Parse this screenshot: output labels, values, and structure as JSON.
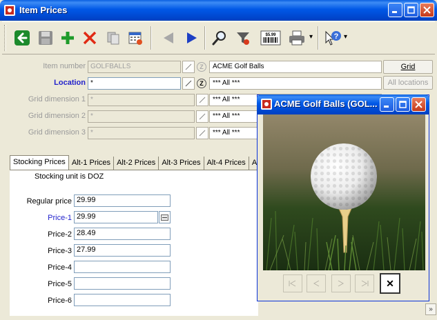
{
  "window": {
    "title": "Item Prices",
    "minimize": "_",
    "maximize": "□",
    "close": "✕"
  },
  "toolbar": {
    "items": [
      {
        "name": "back-button",
        "icon": "green-left-arrow-icon"
      },
      {
        "name": "save-button",
        "icon": "floppy-disk-icon"
      },
      {
        "name": "new-button",
        "icon": "green-plus-icon"
      },
      {
        "name": "delete-button",
        "icon": "red-x-icon"
      },
      {
        "name": "copy-button",
        "icon": "copy-icon"
      },
      {
        "name": "calendar-button",
        "icon": "calendar-icon"
      },
      {
        "name": "previous-button",
        "icon": "grey-left-triangle-icon"
      },
      {
        "name": "next-button",
        "icon": "blue-right-triangle-icon"
      },
      {
        "name": "lookup-button",
        "icon": "magnifier-icon"
      },
      {
        "name": "filter-button",
        "icon": "funnel-icon"
      },
      {
        "name": "barcode-price-button",
        "icon": "barcode-icon",
        "label": "$5.99"
      },
      {
        "name": "print-button",
        "icon": "printer-icon"
      },
      {
        "name": "help-button",
        "icon": "question-cursor-icon"
      }
    ],
    "dropdown_arrow": "▾"
  },
  "form": {
    "item_number": {
      "label": "Item number",
      "value": "GOLFBALLS",
      "description": "ACME Golf Balls"
    },
    "location": {
      "label": "Location",
      "value": "*",
      "description": "*** All ***"
    },
    "grid_dim_1": {
      "label": "Grid dimension 1",
      "value": "*",
      "description": "*** All ***"
    },
    "grid_dim_2": {
      "label": "Grid dimension 2",
      "value": "*",
      "description": "*** All ***"
    },
    "grid_dim_3": {
      "label": "Grid dimension 3",
      "value": "*",
      "description": "*** All ***"
    },
    "z_label": "Z"
  },
  "side_buttons": {
    "grid": "Grid",
    "all_locations": "All locations"
  },
  "tabs": [
    "Stocking Prices",
    "Alt-1 Prices",
    "Alt-2 Prices",
    "Alt-3 Prices",
    "Alt-4 Prices",
    "A"
  ],
  "prices": {
    "stocking_unit_text": "Stocking unit is DOZ",
    "rows": [
      {
        "label": "Regular price",
        "value": "29.99"
      },
      {
        "label": "Price-1",
        "value": "29.99"
      },
      {
        "label": "Price-2",
        "value": "28.49"
      },
      {
        "label": "Price-3",
        "value": "27.99"
      },
      {
        "label": "Price-4",
        "value": ""
      },
      {
        "label": "Price-5",
        "value": ""
      },
      {
        "label": "Price-6",
        "value": ""
      }
    ],
    "price1_button": "–"
  },
  "popup": {
    "title": "ACME Golf Balls (GOL...",
    "image": "golf-ball-on-tee-photo",
    "nav": {
      "first": "|◁",
      "prev": "◁",
      "next": "▷",
      "last": "▷|",
      "close": "✕"
    }
  },
  "scroll_more": "»",
  "colors": {
    "title_blue": "#0058e6",
    "label_blue": "#2222cc",
    "window_bg": "#ece9d8"
  }
}
